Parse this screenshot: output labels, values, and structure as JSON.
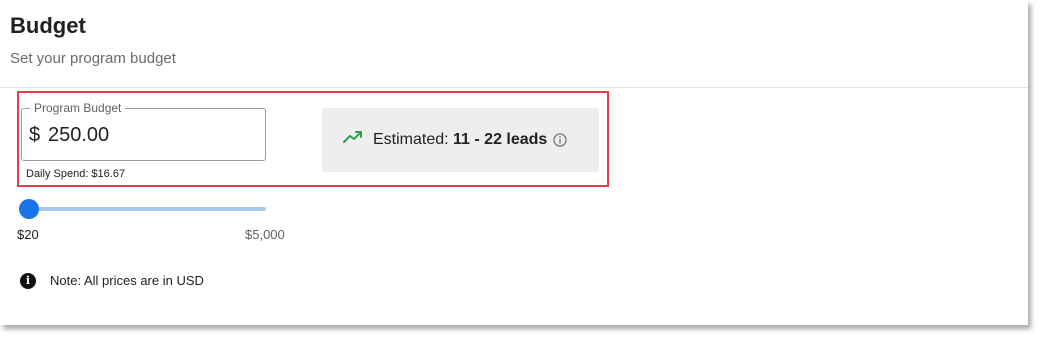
{
  "header": {
    "title": "Budget",
    "subtitle": "Set your program budget"
  },
  "budget": {
    "label": "Program Budget",
    "currency_symbol": "$",
    "value": "250.00",
    "daily_spend": "Daily Spend: $16.67"
  },
  "estimate": {
    "prefix": "Estimated: ",
    "leads": "11 - 22 leads",
    "icon": "trending-up-icon",
    "info_icon": "info-outline-icon"
  },
  "slider": {
    "min_label": "$20",
    "max_label": "$5,000",
    "position_fraction": 0.047
  },
  "note": {
    "icon": "info-filled-icon",
    "text": "Note: All prices are in USD"
  },
  "colors": {
    "accent": "#1a73e8",
    "highlight": "#e53e4a",
    "trend": "#2e9e4f"
  }
}
